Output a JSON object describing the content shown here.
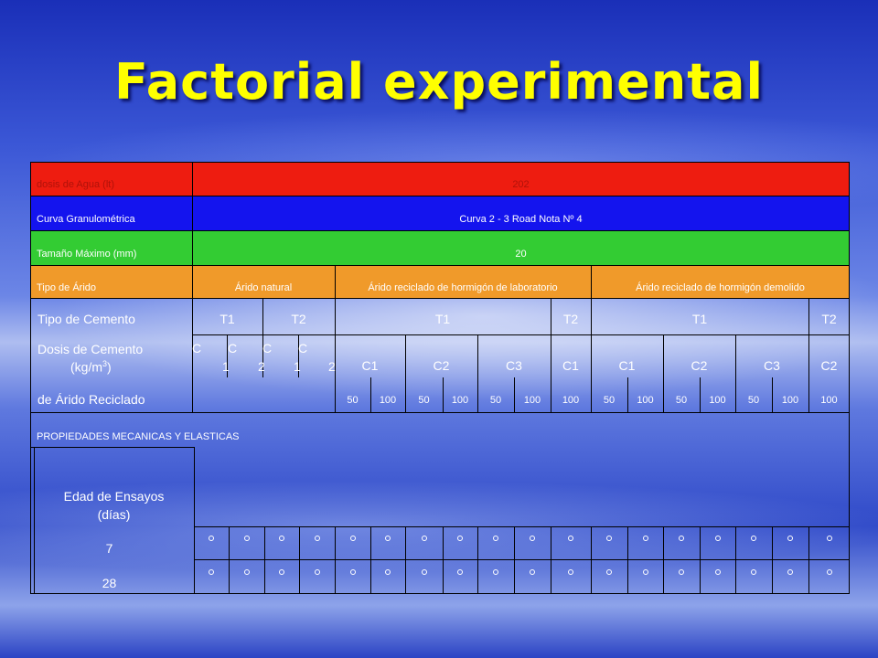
{
  "title": "Factorial experimental",
  "colors": {
    "red": "#ee1c10",
    "blue": "#1414ee",
    "green": "#33cc33",
    "orange": "#f09a2a",
    "title": "#ffff00"
  },
  "rows": {
    "water_label": "dosis de Agua (lt)",
    "water_value": "202",
    "curve_label": "Curva Granulométrica",
    "curve_value": "Curva 2 - 3 Road Nota Nº 4",
    "size_label": "Tamaño Máximo (mm)",
    "size_value": "20",
    "aggregate_label": "Tipo de Árido",
    "aggregate_natural": "Árido natural",
    "aggregate_lab": "Árido reciclado de hormigón de laboratorio",
    "aggregate_demolished": "Árido reciclado de hormigón demolido",
    "cement_type_label": "Tipo de Cemento",
    "cement_types": [
      "T1",
      "T2",
      "T1",
      "T2",
      "T1",
      "T2"
    ],
    "cement_dose_label_line1": "Dosis de Cemento",
    "cement_dose_label_line2": "(kg/m",
    "cement_dose_sup": "3",
    "cement_dose_close": ")",
    "natural_doses_top": [
      "C",
      "C",
      "C",
      "C"
    ],
    "natural_doses_bottom": [
      "1",
      "2",
      "1",
      "2"
    ],
    "recycled_doses": [
      "C1",
      "C2",
      "C3",
      "C1",
      "C1",
      "C2",
      "C3",
      "C2"
    ],
    "recycled_label": "de Árido Reciclado",
    "percentages": [
      "50",
      "100",
      "50",
      "100",
      "50",
      "100",
      "100",
      "50",
      "100",
      "50",
      "100",
      "50",
      "100",
      "100"
    ],
    "properties_label": "PROPIEDADES MECANICAS Y ELASTICAS",
    "age_label_line1": "Edad de Ensayos",
    "age_label_line2": "(días)",
    "age_7": "7",
    "age_28": "28"
  }
}
